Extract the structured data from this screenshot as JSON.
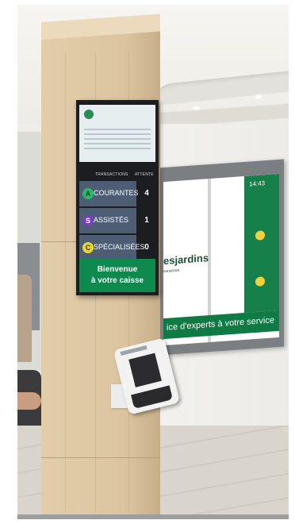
{
  "kiosk": {
    "header": {
      "transactions": "TRANSACTIONS",
      "waiting": "ATTENTE"
    },
    "rows": [
      {
        "letter": "A",
        "label": "COURANTES",
        "count": "4",
        "color": "#2eb86a"
      },
      {
        "letter": "S",
        "label": "ASSISTÉS",
        "count": "1",
        "color": "#7a3fbf"
      },
      {
        "letter": "C",
        "label": "SPÉCIALISÉES",
        "count": "0",
        "color": "#e5d633"
      }
    ],
    "welcome_line1": "Bienvenue",
    "welcome_line2": "à votre caisse"
  },
  "wall_screen": {
    "brand": "esjardins",
    "subtitle": "surances",
    "tagline": "ice d'experts à votre service",
    "time": "14:43"
  }
}
